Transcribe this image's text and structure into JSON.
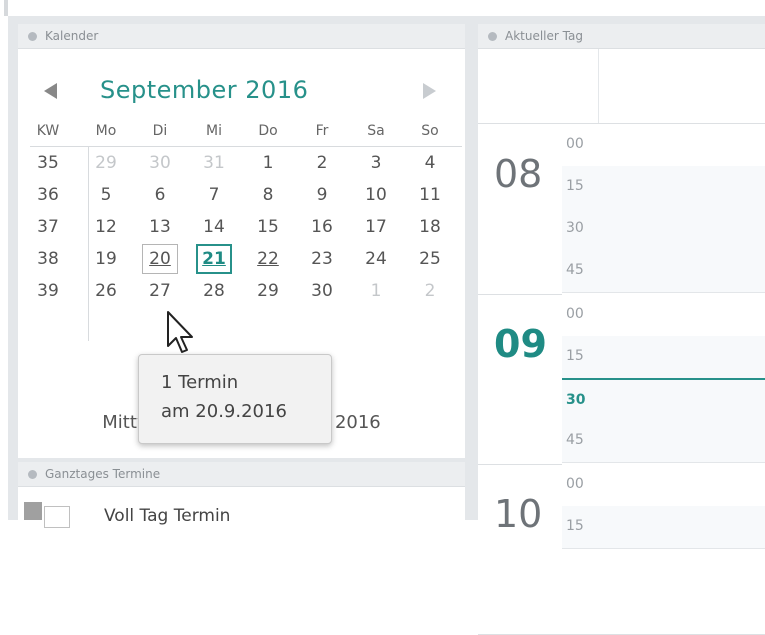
{
  "calendar": {
    "panel_title": "Kalender",
    "month_label": "September  2016",
    "headers": [
      "KW",
      "Mo",
      "Di",
      "Mi",
      "Do",
      "Fr",
      "Sa",
      "So"
    ],
    "weeks": [
      {
        "kw": "35",
        "days": [
          "29",
          "30",
          "31",
          "1",
          "2",
          "3",
          "4"
        ]
      },
      {
        "kw": "36",
        "days": [
          "5",
          "6",
          "7",
          "8",
          "9",
          "10",
          "11"
        ]
      },
      {
        "kw": "37",
        "days": [
          "12",
          "13",
          "14",
          "15",
          "16",
          "17",
          "18"
        ]
      },
      {
        "kw": "38",
        "days": [
          "19",
          "20",
          "21",
          "22",
          "23",
          "24",
          "25"
        ]
      },
      {
        "kw": "39",
        "days": [
          "26",
          "27",
          "28",
          "29",
          "30",
          "1",
          "2"
        ]
      }
    ],
    "date_line": "Mittwoch, 21. September 2016",
    "tooltip": {
      "line1": "1 Termin",
      "line2": "am 20.9.2016"
    }
  },
  "allday": {
    "panel_title": "Ganztages Termine",
    "items": [
      "Voll Tag Termin"
    ]
  },
  "day": {
    "panel_title": "Aktueller Tag",
    "hours": [
      {
        "hour": "08",
        "slots": [
          "00",
          "15",
          "30",
          "45"
        ]
      },
      {
        "hour": "09",
        "slots": [
          "00",
          "15",
          "30",
          "45"
        ]
      },
      {
        "hour": "10",
        "slots": [
          "00",
          "15"
        ]
      }
    ]
  },
  "colors": {
    "accent": "#27918a",
    "header_bg": "#eceef0",
    "frame": "#e4e7ea"
  }
}
